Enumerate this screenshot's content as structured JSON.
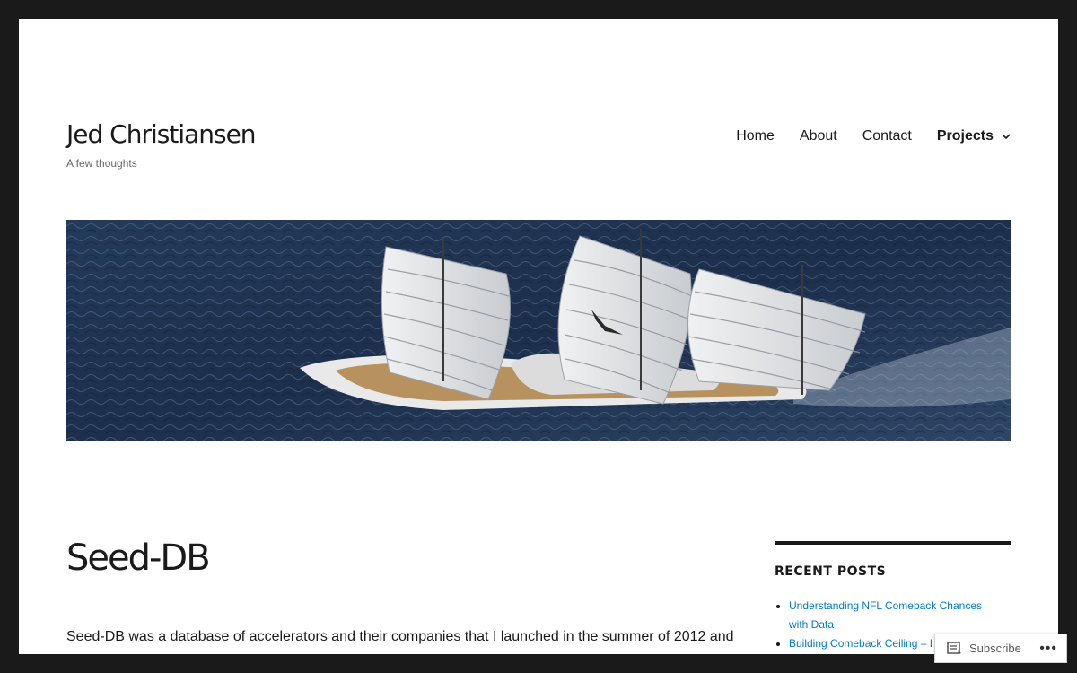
{
  "site": {
    "title": "Jed Christiansen",
    "description": "A few thoughts"
  },
  "nav": {
    "items": [
      {
        "label": "Home"
      },
      {
        "label": "About"
      },
      {
        "label": "Contact"
      },
      {
        "label": "Projects"
      }
    ],
    "dropdown_icon": "chevron-down-icon"
  },
  "hero": {
    "image_desc": "hero-image",
    "colors": {
      "sea": "#1c2f4c",
      "sail": "#dfe1e3",
      "deck": "#b7915e"
    }
  },
  "entry": {
    "title": "Seed-DB",
    "text": "Seed-DB was a database of accelerators and their companies that I launched in the summer of 2012 and"
  },
  "sidebar": {
    "recent_posts": {
      "title": "RECENT POSTS",
      "posts": [
        {
          "line1": "Understanding NFL Comeback Chances",
          "line2": "with Data"
        },
        {
          "line1": "Building Comeback Ceiling – I",
          "line2": ""
        }
      ]
    }
  },
  "subscribe": {
    "label": "Subscribe",
    "more": "•••"
  },
  "colors": {
    "background": "#1a1a1a",
    "link": "#007acc",
    "text": "#1a1a1a"
  }
}
